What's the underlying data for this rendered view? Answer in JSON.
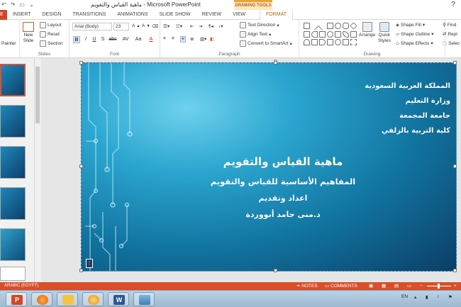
{
  "titlebar": {
    "qat_icons": [
      "undo-icon",
      "redo-icon",
      "slideshow-start-icon",
      "customize-icon"
    ],
    "window_title": "ماهية القياس والتقويم - Microsoft PowerPoint",
    "contextual_tab_group": "DRAWING TOOLS",
    "help_label": "?"
  },
  "tabs": [
    "E",
    "INSERT",
    "DESIGN",
    "TRANSITIONS",
    "ANIMATIONS",
    "SLIDE SHOW",
    "REVIEW",
    "VIEW",
    "FORMAT"
  ],
  "ribbon": {
    "clipboard": {
      "painter_label": "Painter"
    },
    "slides": {
      "new_slide_label": "New",
      "new_slide_label2": "Slide",
      "layout_label": "Layout",
      "reset_label": "Reset",
      "section_label": "Section",
      "group_label": "Slides"
    },
    "font": {
      "font_name": "Arial (Body)",
      "font_size": "23",
      "bold_label": "B",
      "italic_label": "I",
      "underline_label": "U",
      "shadow_label": "S",
      "strike_label": "abc",
      "spacing_label": "AV",
      "case_label": "Aa",
      "color_label": "A",
      "group_label": "Font"
    },
    "paragraph": {
      "text_direction_label": "Text Direction",
      "align_text_label": "Align Text",
      "smartart_label": "Convert to SmartArt",
      "group_label": "Paragraph"
    },
    "drawing": {
      "arrange_label": "Arrange",
      "quick_styles_label": "Quick",
      "quick_styles_label2": "Styles",
      "shape_fill_label": "Shape Fill",
      "shape_outline_label": "Shape Outline",
      "shape_effects_label": "Shape Effects",
      "group_label": "Drawing"
    },
    "editing": {
      "find_label": "Find",
      "replace_label": "Repl",
      "select_label": "Selec"
    }
  },
  "slide": {
    "org_lines": [
      "المملكة العربية السعودية",
      "وزارة التعليم",
      "جامعة المجمعة",
      "كلية التربية بالزلفي"
    ],
    "title": "ماهية القياس والتقويم",
    "subtitle": "المفاهيم الأساسية للقياس والتقويم",
    "prepared_by": "اعداد وتقديم",
    "author": "د.منى حامد أبووردة"
  },
  "statusbar": {
    "language": "ARABIC (EGYPT)",
    "notes_label": "NOTES",
    "comments_label": "COMMENTS"
  },
  "taskbar": {
    "apps": [
      "powerpoint-icon",
      "firefox-icon",
      "file-explorer-icon",
      "media-player-icon",
      "word-icon",
      "image-viewer-icon"
    ],
    "lang_indicator": "EN"
  },
  "colors": {
    "accent": "#d24726",
    "contextual": "#e8a33c",
    "slide_dark": "#0b3e66",
    "slide_light": "#6fd1ee"
  }
}
